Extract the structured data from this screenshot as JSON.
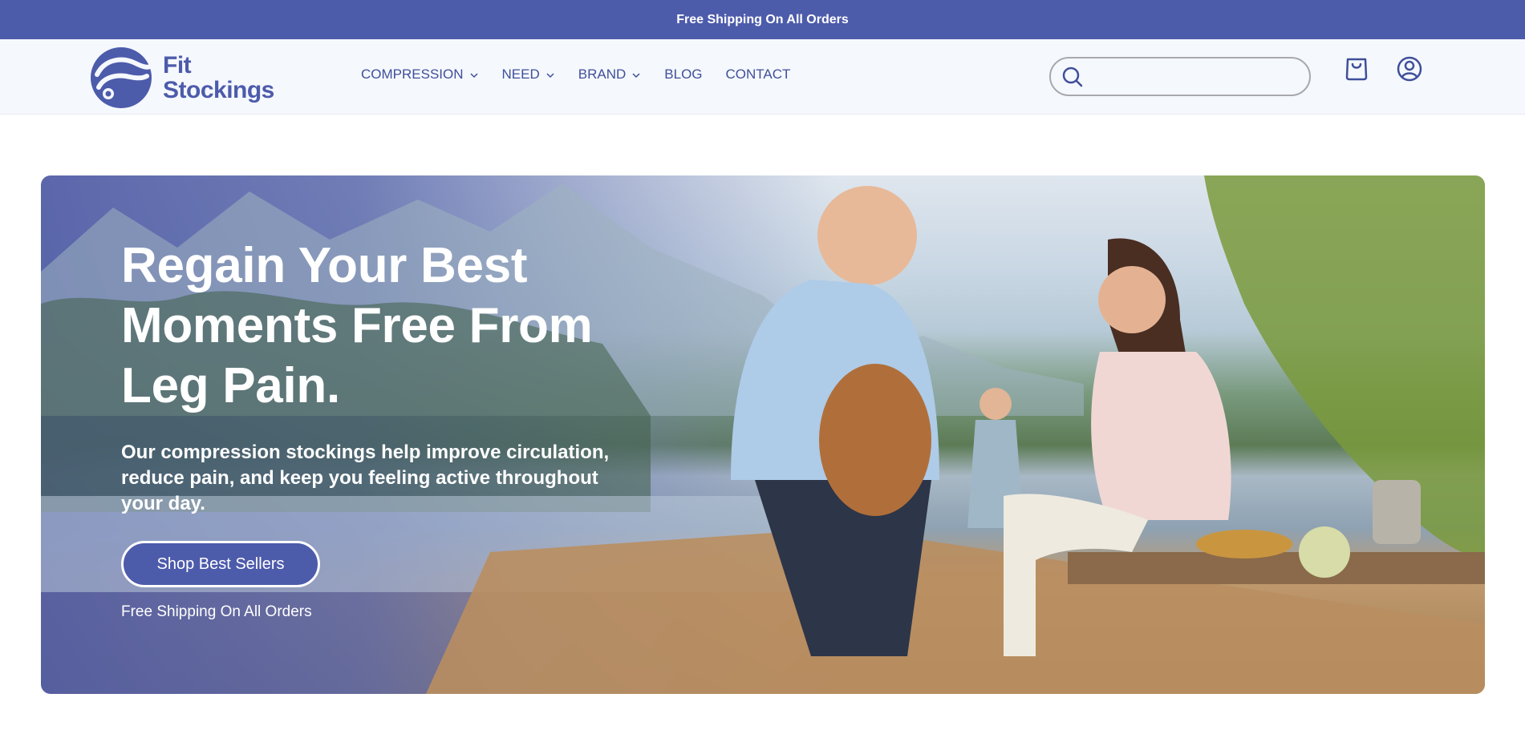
{
  "announcement": {
    "text": "Free Shipping On All Orders"
  },
  "brand": {
    "line1": "Fit",
    "line2": "Stockings",
    "color": "#4d5bab"
  },
  "nav": {
    "items": [
      {
        "label": "COMPRESSION",
        "dropdown": true
      },
      {
        "label": "NEED",
        "dropdown": true
      },
      {
        "label": "BRAND",
        "dropdown": true
      },
      {
        "label": "BLOG",
        "dropdown": false
      },
      {
        "label": "CONTACT",
        "dropdown": false
      }
    ]
  },
  "search": {
    "placeholder": "",
    "value": ""
  },
  "icons": {
    "search": "search-icon",
    "cart": "shopping-bag-icon",
    "account": "user-account-icon"
  },
  "hero": {
    "title": "Regain Your Best Moments Free From Leg Pain.",
    "subtitle": "Our compression stockings help improve circulation, reduce pain, and keep you feeling active throughout your day.",
    "cta_label": "Shop Best Sellers",
    "note": "Free Shipping On All Orders"
  },
  "colors": {
    "accent": "#4d5bab",
    "header_bg": "#f5f8fd",
    "nav_text": "#3f4f9a"
  }
}
